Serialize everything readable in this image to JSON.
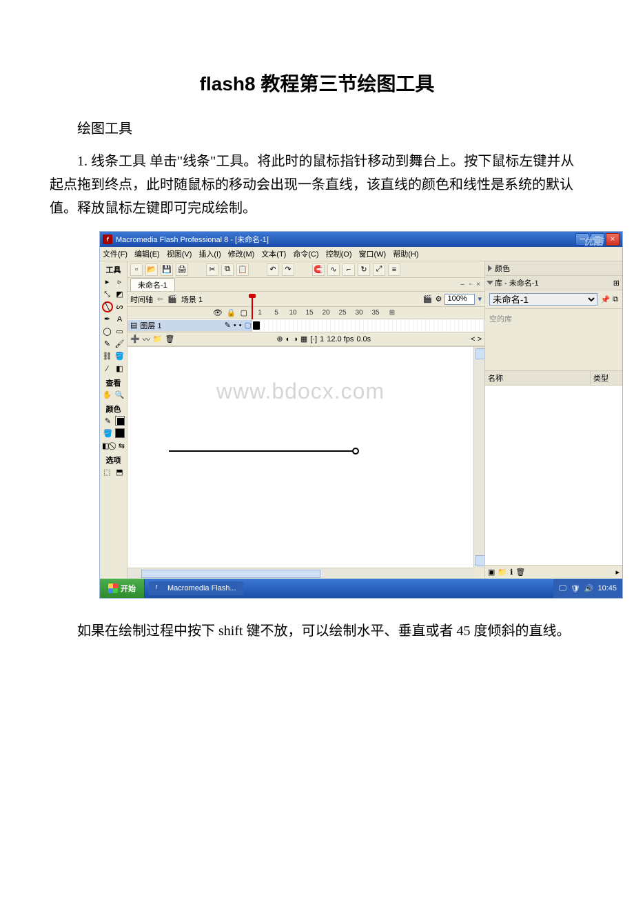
{
  "doc": {
    "title": "flash8 教程第三节绘图工具",
    "subtitle": "绘图工具",
    "para1": "1. 线条工具 单击\"线条\"工具。将此时的鼠标指针移动到舞台上。按下鼠标左键并从起点拖到终点，此时随鼠标的移动会出现一条直线，该直线的颜色和线性是系统的默认值。释放鼠标左键即可完成绘制。",
    "para2": "如果在绘制过程中按下 shift 键不放，可以绘制水平、垂直或者 45 度倾斜的直线。"
  },
  "app": {
    "window_title": "Macromedia Flash Professional 8 - [未命名-1]",
    "youku_mark": "优酷",
    "menu": [
      "文件(F)",
      "编辑(E)",
      "视图(V)",
      "插入(I)",
      "修改(M)",
      "文本(T)",
      "命令(C)",
      "控制(O)",
      "窗口(W)",
      "帮助(H)"
    ],
    "doc_tab": "未命名-1",
    "doc_subctrl": "– ▫ ×",
    "timeline_label": "时间轴",
    "scene_label": "场景 1",
    "zoom_value": "100%",
    "layer_name": "图层 1",
    "ruler_ticks": [
      "1",
      "5",
      "10",
      "15",
      "20",
      "25",
      "30",
      "35"
    ],
    "ruler_end": "⊞",
    "tl_status": {
      "frame": "1",
      "fps": "12.0 fps",
      "time": "0.0s",
      "nav": "< >"
    },
    "toolbox": {
      "title": "工具",
      "view": "查看",
      "color": "颜色",
      "options": "选项"
    },
    "panels": {
      "color": "颜色",
      "library_head": "库 - 未命名-1",
      "library_doc": "未命名-1",
      "empty": "空的库",
      "col_name": "名称",
      "col_type": "类型"
    },
    "watermark": "www.bdocx.com",
    "taskbar": {
      "start": "开始",
      "task": "Macromedia Flash...",
      "clock": "10:45"
    }
  }
}
